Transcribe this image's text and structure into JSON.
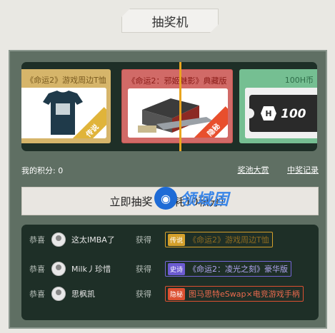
{
  "page": {
    "title": "抽奖机"
  },
  "carousel": {
    "cards": [
      {
        "name": "《命运2》游戏周边T恤",
        "image": "t-shirt",
        "ribbon": "传说",
        "color": "#d6b56a"
      },
      {
        "name": "《命运2：邪姬魅影》典藏版",
        "image": "collectors-edition",
        "ribbon": "隐秘",
        "color": "#d16a67"
      },
      {
        "name": "100H币",
        "image": "h-coin-ticket",
        "ticket_text": "100",
        "color": "#75bf92"
      }
    ]
  },
  "stats": {
    "points_label": "我的积分: 0",
    "pool_link": "奖池大赏",
    "records_link": "中奖记录"
  },
  "draw_button": {
    "label": "立即抽奖（消耗10积分）"
  },
  "watermark": {
    "text": "领域固"
  },
  "feed": [
    {
      "congrats": "恭喜",
      "user": "这太IMBA了",
      "got": "获得",
      "tag": "传说",
      "prize": "《命运2》游戏周边T恤",
      "tier": "legend"
    },
    {
      "congrats": "恭喜",
      "user": "Milk丿珍惜",
      "got": "获得",
      "tag": "史诗",
      "prize": "《命运2：凌光之刻》豪华版",
      "tier": "epic"
    },
    {
      "congrats": "恭喜",
      "user": "思枫凯",
      "got": "获得",
      "tag": "隐秘",
      "prize": "图马思特eSwap×电竞游戏手柄",
      "tier": "rare"
    }
  ],
  "colors": {
    "panel": "#5f6f63",
    "dark": "#1e2f27",
    "pointer": "#e9a51f"
  }
}
